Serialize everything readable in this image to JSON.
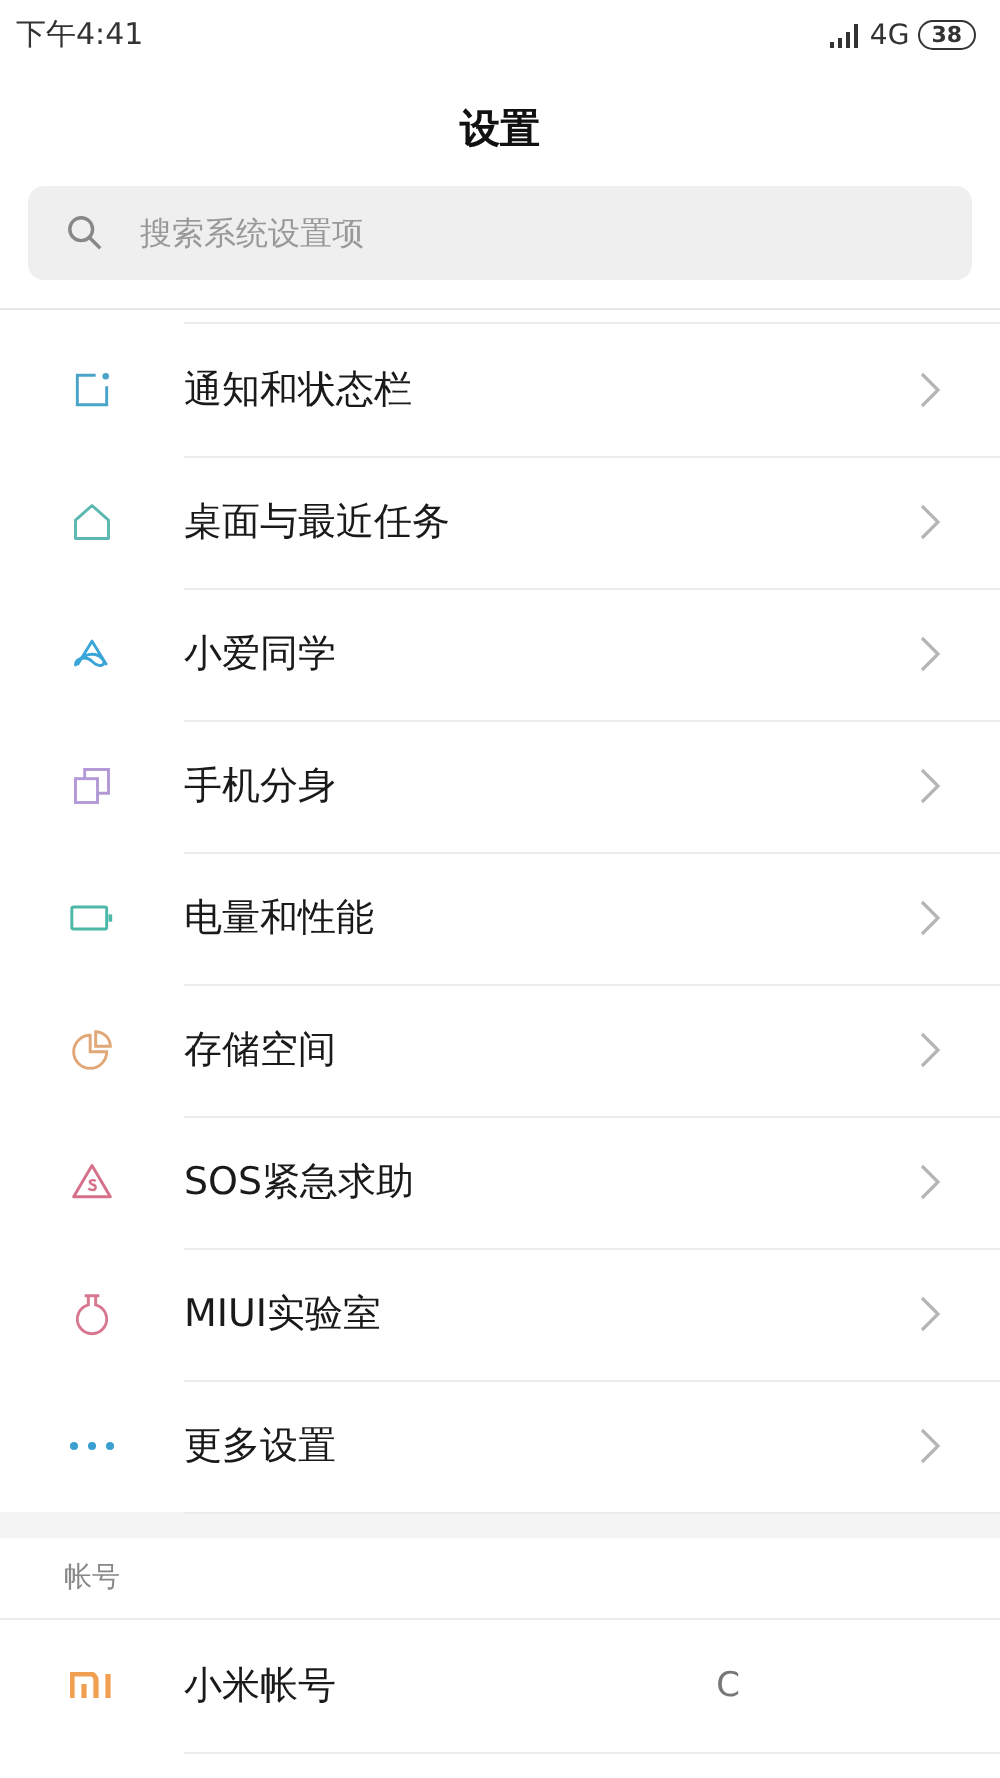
{
  "status_bar": {
    "time": "下午4:41",
    "network": "4G",
    "battery": "38"
  },
  "title": "设置",
  "search": {
    "placeholder": "搜索系统设置项"
  },
  "items": [
    {
      "label": "通知和状态栏",
      "chevron": true
    },
    {
      "label": "桌面与最近任务",
      "chevron": true
    },
    {
      "label": "小爱同学",
      "chevron": true
    },
    {
      "label": "手机分身",
      "chevron": true
    },
    {
      "label": "电量和性能",
      "chevron": true
    },
    {
      "label": "存储空间",
      "chevron": true
    },
    {
      "label": "SOS紧急求助",
      "chevron": true
    },
    {
      "label": "MIUI实验室",
      "chevron": true
    },
    {
      "label": "更多设置",
      "chevron": true
    }
  ],
  "account_section": {
    "header": "帐号",
    "items": [
      {
        "label": "小米帐号",
        "value": "C",
        "chevron": false
      }
    ]
  }
}
